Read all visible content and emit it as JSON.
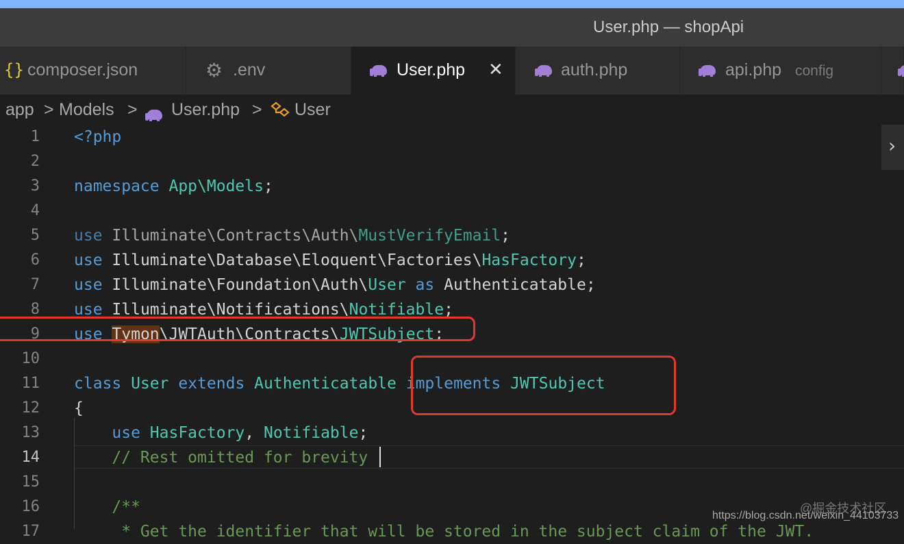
{
  "window": {
    "title": "User.php — shopApi"
  },
  "tabs": [
    {
      "label": "composer.json",
      "icon": "braces-icon",
      "description": ""
    },
    {
      "label": ".env",
      "icon": "gear-icon",
      "description": ""
    },
    {
      "label": "User.php",
      "icon": "php-elephant-icon",
      "description": "",
      "close": "✕"
    },
    {
      "label": "auth.php",
      "icon": "php-elephant-icon",
      "description": ""
    },
    {
      "label": "api.php",
      "icon": "php-elephant-icon",
      "description": "config"
    }
  ],
  "breadcrumb": {
    "items": [
      "app",
      "Models",
      "User.php",
      "User"
    ],
    "separator": ">"
  },
  "editor": {
    "current_line": "14",
    "line_numbers": [
      "1",
      "2",
      "3",
      "4",
      "5",
      "6",
      "7",
      "8",
      "9",
      "10",
      "11",
      "12",
      "13",
      "14",
      "15",
      "16",
      "17"
    ],
    "lines": {
      "l1": {
        "open": "<?php"
      },
      "l3": {
        "kw": "namespace",
        "ns": "App\\Models",
        "end": ";"
      },
      "l5": {
        "kw": "use",
        "path": "Illuminate\\Contracts\\Auth\\",
        "cls": "MustVerifyEmail",
        "end": ";"
      },
      "l6": {
        "kw": "use",
        "path": "Illuminate\\Database\\Eloquent\\Factories\\",
        "cls": "HasFactory",
        "end": ";"
      },
      "l7": {
        "kw": "use",
        "path": "Illuminate\\Foundation\\Auth\\",
        "cls": "User",
        "as": "as",
        "alias": "Authenticatable",
        "end": ";"
      },
      "l8": {
        "kw": "use",
        "path": "Illuminate\\Notifications\\",
        "cls": "Notifiable",
        "end": ";"
      },
      "l9": {
        "kw": "use",
        "hl": "Tymon",
        "path": "\\JWTAuth\\Contracts\\",
        "cls": "JWTSubject",
        "end": ";"
      },
      "l11": {
        "kw_class": "class",
        "name": "User",
        "kw_extends": "extends",
        "parent": "Authenticatable",
        "kw_implements": "implements",
        "iface": "JWTSubject"
      },
      "l12": {
        "brace": "{"
      },
      "l13": {
        "kw": "use",
        "t1": "HasFactory",
        "comma": ", ",
        "t2": "Notifiable",
        "end": ";"
      },
      "l14": {
        "comment": "// Rest omitted for brevity"
      },
      "l16": {
        "comment": "/**"
      },
      "l17": {
        "comment": " * Get the identifier that will be stored in the subject claim of the JWT."
      }
    }
  },
  "watermark": {
    "line1": "@掘金技术社区",
    "line2": "https://blog.csdn.net/weixin_44103733"
  },
  "colors": {
    "keyword": "#569cd6",
    "type": "#4ec9b0",
    "comment": "#6a9955",
    "highlight": "#e03a2b"
  }
}
